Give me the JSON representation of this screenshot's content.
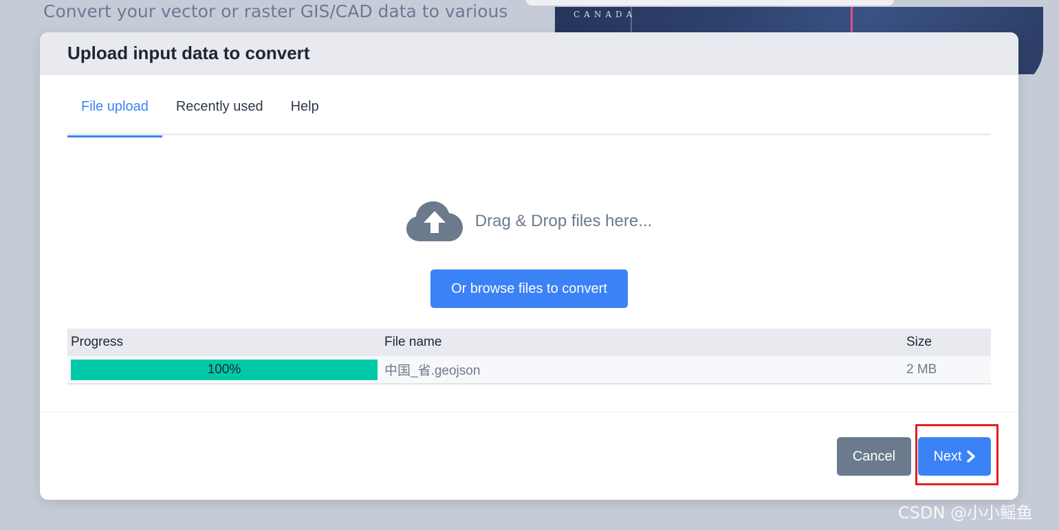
{
  "background": {
    "heading": "Convert your vector or raster GIS/CAD data to various",
    "map_label": "CANADA"
  },
  "modal": {
    "title": "Upload input data to convert",
    "tabs": [
      {
        "label": "File upload",
        "active": true
      },
      {
        "label": "Recently used",
        "active": false
      },
      {
        "label": "Help",
        "active": false
      }
    ],
    "dropzone": {
      "icon": "cloud-upload-icon",
      "text": "Drag & Drop files here..."
    },
    "browse_label": "Or browse files to convert",
    "table": {
      "headers": [
        "Progress",
        "File name",
        "Size"
      ],
      "rows": [
        {
          "progress": 1.0,
          "progress_label": "100%",
          "file_name": "中国_省.geojson",
          "size": "2 MB"
        }
      ]
    },
    "footer": {
      "cancel_label": "Cancel",
      "next_label": "Next",
      "next_icon": "chevron-right-icon"
    }
  },
  "watermark": "CSDN @小小鳐鱼",
  "colors": {
    "accent": "#3b82f6",
    "progress": "#00c9a7",
    "cancel": "#6b7a8d",
    "highlight": "#e0201e"
  }
}
